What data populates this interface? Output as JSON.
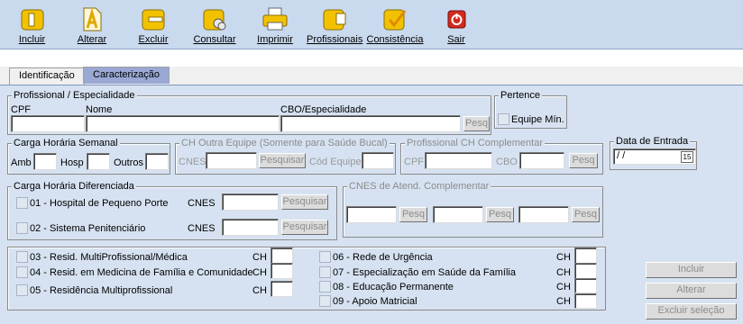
{
  "toolbar": {
    "incluir": "Incluir",
    "alterar": "Alterar",
    "excluir": "Excluir",
    "consultar": "Consultar",
    "imprimir": "Imprimir",
    "profissionais": "Profissionais",
    "consistencia": "Consistência",
    "sair": "Sair"
  },
  "tabs": {
    "identificacao": "Identificação",
    "caracterizacao": "Caracterização"
  },
  "prof": {
    "title": "Profissional / Especialidade",
    "cpf": "CPF",
    "nome": "Nome",
    "cbo": "CBO/Especialidade",
    "pesq": "Pesq"
  },
  "pertence": {
    "title": "Pertence",
    "equipe_min": "Equipe Mín."
  },
  "carga": {
    "title": "Carga Horária Semanal",
    "amb": "Amb",
    "hosp": "Hosp",
    "outros": "Outros"
  },
  "ch_outra": {
    "title": "CH Outra Equipe (Somente para Saúde Bucal)",
    "cnes": "CNES",
    "pesquisar": "Pesquisar",
    "cod_equipe": "Cód Equipe"
  },
  "prof_ch": {
    "title": "Profissional CH Complementar",
    "cpf": "CPF",
    "cbo": "CBO",
    "pesq": "Pesq"
  },
  "data_entrada": {
    "title": "Data de Entrada",
    "value": " /  /",
    "calendar": "15"
  },
  "carga_dif": {
    "title": "Carga Horária Diferenciada",
    "item1": "01 - Hospital de Pequeno Porte",
    "item2": "02 - Sistema Penitenciário",
    "cnes": "CNES",
    "pesquisar": "Pesquisar"
  },
  "cnes_atend": {
    "title": "CNES de Atend. Complementar",
    "pesq": "Pesq"
  },
  "residencias": {
    "left": [
      "03 - Resid. MultiProfissional/Médica",
      "04 - Resid. em Medicina de Família e Comunidade",
      "05 - Residência Multiprofissional"
    ],
    "right": [
      "06 - Rede de Urgência",
      "07 - Especialização em Saúde da Família",
      "08 - Educação Permanente",
      "09 - Apoio Matricial"
    ],
    "ch": "CH"
  },
  "actions": {
    "incluir": "Incluir",
    "alterar": "Alterar",
    "excluir_selecao": "Excluir seleção"
  },
  "colors": {
    "toolbar_bg": "#c9d9ee",
    "panel_bg": "#d6e2f1",
    "active_tab": "#9aa8d4",
    "sair_icon": "#d42a1e",
    "folder_icon": "#f2c200"
  }
}
